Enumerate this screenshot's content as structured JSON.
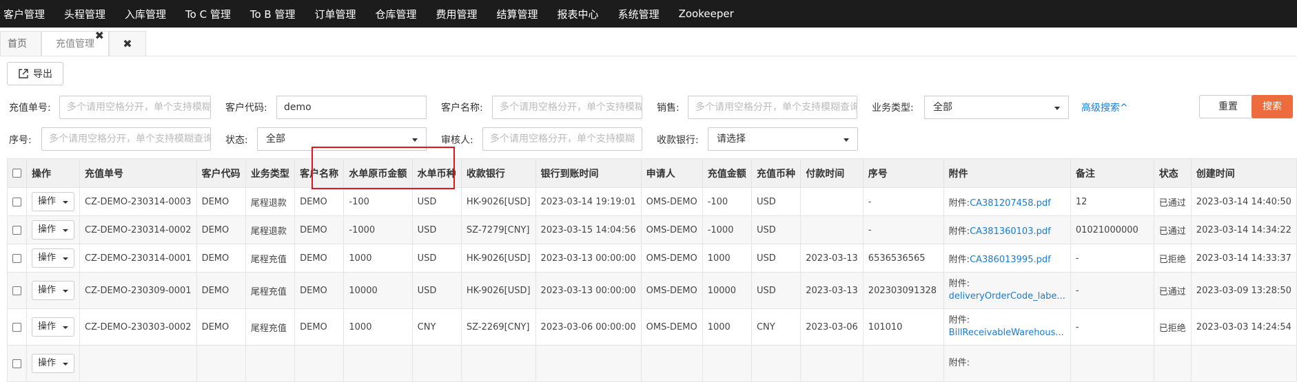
{
  "topnav": [
    "客户管理",
    "头程管理",
    "入库管理",
    "To C 管理",
    "To B 管理",
    "订单管理",
    "仓库管理",
    "费用管理",
    "结算管理",
    "报表中心",
    "系统管理",
    "Zookeeper"
  ],
  "tabs": {
    "home": "首页",
    "active": "充值管理",
    "active_close": "✖",
    "close_all": "✖"
  },
  "toolbar": {
    "export_label": "导出"
  },
  "filters": {
    "recharge_no_label": "充值单号:",
    "recharge_no_placeholder": "多个请用空格分开，单个支持模糊",
    "customer_code_label": "客户代码:",
    "customer_code_value": "demo",
    "customer_name_label": "客户名称:",
    "customer_name_placeholder": "多个请用空格分开，单个支持模糊",
    "sales_label": "销售:",
    "sales_placeholder": "多个请用空格分开，单个支持模糊查询",
    "biz_type_label": "业务类型:",
    "biz_type_value": "全部",
    "advanced_search": "高级搜索^",
    "reset_label": "重置",
    "search_label": "搜索",
    "serial_label": "序号:",
    "serial_placeholder": "多个请用空格分开，单个支持模糊查询",
    "status_label": "状态:",
    "status_value": "全部",
    "reviewer_label": "审核人:",
    "reviewer_placeholder": "多个请用空格分开，单个支持模糊",
    "bank_label": "收款银行:",
    "bank_value": "请选择"
  },
  "table": {
    "headers": [
      "操作",
      "充值单号",
      "客户代码",
      "业务类型",
      "客户名称",
      "水单原币金额",
      "水单币种",
      "收款银行",
      "银行到账时间",
      "申请人",
      "充值金额",
      "充值币种",
      "付款时间",
      "序号",
      "附件",
      "备注",
      "状态",
      "创建时间"
    ],
    "op_label": "操作",
    "attach_prefix": "附件:",
    "rows": [
      {
        "no": "CZ-DEMO-230314-0003",
        "code": "DEMO",
        "biz": "尾程退款",
        "name": "DEMO",
        "orig_amount": "-100",
        "orig_cur": "USD",
        "bank": "HK-9026[USD]",
        "arrive": "2023-03-14 19:19:01",
        "applicant": "OMS-DEMO",
        "amount": "-100",
        "cur": "USD",
        "pay_time": "",
        "serial": "-",
        "attach": "CA381207458.pdf",
        "remark": "12",
        "status": "已通过",
        "created": "2023-03-14 14:40:50"
      },
      {
        "no": "CZ-DEMO-230314-0002",
        "code": "DEMO",
        "biz": "尾程退款",
        "name": "DEMO",
        "orig_amount": "-1000",
        "orig_cur": "USD",
        "bank": "SZ-7279[CNY]",
        "arrive": "2023-03-15 14:04:56",
        "applicant": "OMS-DEMO",
        "amount": "-1000",
        "cur": "USD",
        "pay_time": "",
        "serial": "-",
        "attach": "CA381360103.pdf",
        "remark": "01021000000",
        "status": "已通过",
        "created": "2023-03-14 14:34:22"
      },
      {
        "no": "CZ-DEMO-230314-0001",
        "code": "DEMO",
        "biz": "尾程充值",
        "name": "DEMO",
        "orig_amount": "1000",
        "orig_cur": "USD",
        "bank": "HK-9026[USD]",
        "arrive": "2023-03-13 00:00:00",
        "applicant": "OMS-DEMO",
        "amount": "1000",
        "cur": "USD",
        "pay_time": "2023-03-13",
        "serial": "6536536565",
        "attach": "CA386013995.pdf",
        "remark": "-",
        "status": "已拒绝",
        "created": "2023-03-14 14:33:37"
      },
      {
        "no": "CZ-DEMO-230309-0001",
        "code": "DEMO",
        "biz": "尾程充值",
        "name": "DEMO",
        "orig_amount": "10000",
        "orig_cur": "USD",
        "bank": "HK-9026[USD]",
        "arrive": "2023-03-13 00:00:00",
        "applicant": "OMS-DEMO",
        "amount": "10000",
        "cur": "USD",
        "pay_time": "2023-03-13",
        "serial": "202303091328",
        "attach": "deliveryOrderCode_labe...",
        "remark": "-",
        "status": "已通过",
        "created": "2023-03-09 13:28:50"
      },
      {
        "no": "CZ-DEMO-230303-0002",
        "code": "DEMO",
        "biz": "尾程充值",
        "name": "DEMO",
        "orig_amount": "1000",
        "orig_cur": "CNY",
        "bank": "SZ-2269[CNY]",
        "arrive": "2023-03-06 00:00:00",
        "applicant": "OMS-DEMO",
        "amount": "1000",
        "cur": "CNY",
        "pay_time": "2023-03-06",
        "serial": "101010",
        "attach": "BillReceivableWarehous...",
        "remark": "-",
        "status": "已拒绝",
        "created": "2023-03-03 14:24:54"
      },
      {
        "no": "",
        "code": "",
        "biz": "",
        "name": "",
        "orig_amount": "",
        "orig_cur": "",
        "bank": "",
        "arrive": "",
        "applicant": "",
        "amount": "",
        "cur": "",
        "pay_time": "",
        "serial": "",
        "attach": "",
        "remark": "",
        "status": "",
        "created": ""
      }
    ]
  }
}
